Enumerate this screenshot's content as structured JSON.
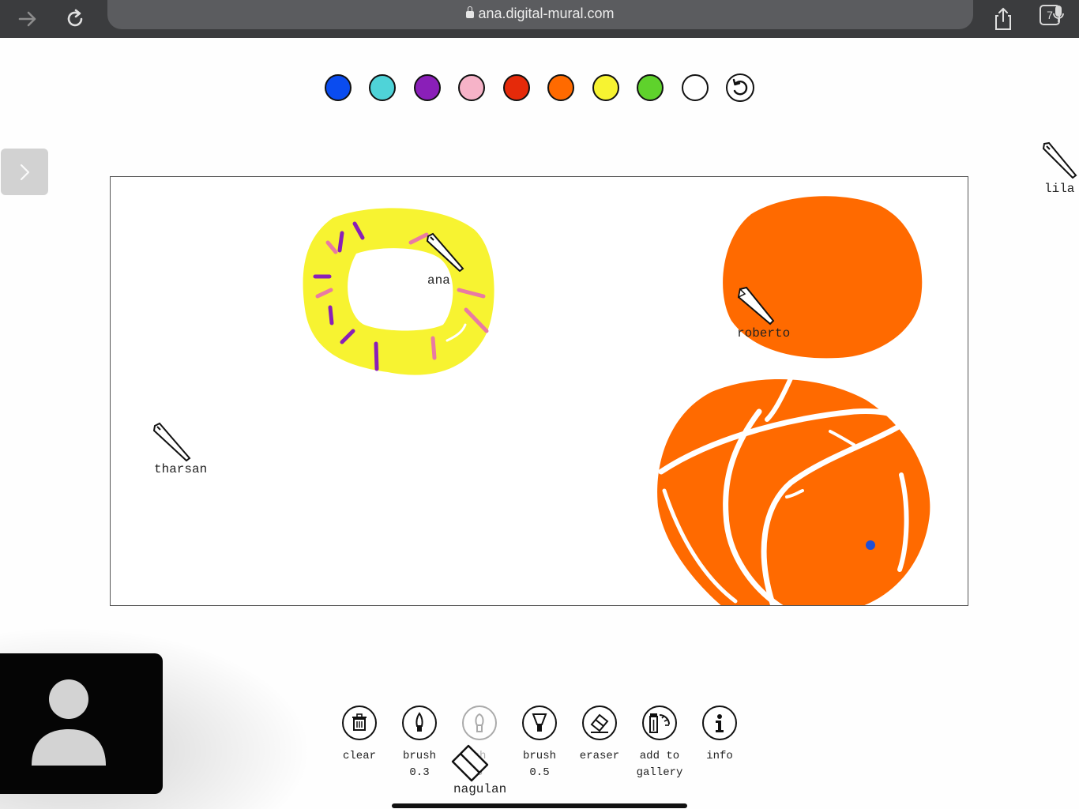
{
  "browser": {
    "url": "ana.digital-mural.com",
    "tab_count": "7",
    "icons": [
      "forward-arrow-icon",
      "reload-icon",
      "lock-icon",
      "microphone-icon",
      "share-icon",
      "tabs-icon"
    ]
  },
  "palette": {
    "colors": [
      {
        "name": "blue",
        "hex": "#0a4cf0"
      },
      {
        "name": "cyan",
        "hex": "#4fd3d8"
      },
      {
        "name": "purple",
        "hex": "#8a1fb8"
      },
      {
        "name": "pink",
        "hex": "#f6b3c8"
      },
      {
        "name": "red",
        "hex": "#e52a0a"
      },
      {
        "name": "orange",
        "hex": "#ff6a00"
      },
      {
        "name": "yellow",
        "hex": "#f7f331"
      },
      {
        "name": "green",
        "hex": "#5fd22c"
      },
      {
        "name": "white",
        "hex": "#ffffff"
      }
    ],
    "undo_icon": "undo-icon"
  },
  "mural": {
    "cursors": [
      {
        "user": "ana"
      },
      {
        "user": "roberto"
      },
      {
        "user": "tharsan"
      },
      {
        "user": "lila"
      }
    ],
    "shape_colors": {
      "yellow": "#f7f331",
      "orange": "#ff6a00",
      "purple": "#8a1fb8",
      "pink": "#e97aa3",
      "dot": "#1f4fd6"
    }
  },
  "toolbar": {
    "clear": "clear",
    "brush_03": "brush\n0.3",
    "brush_faded": "sh\n3",
    "brush_05": "brush\n0.5",
    "eraser": "eraser",
    "add_to_gallery": "add to\ngallery",
    "info": "info",
    "dragging_user": "nagulan"
  }
}
